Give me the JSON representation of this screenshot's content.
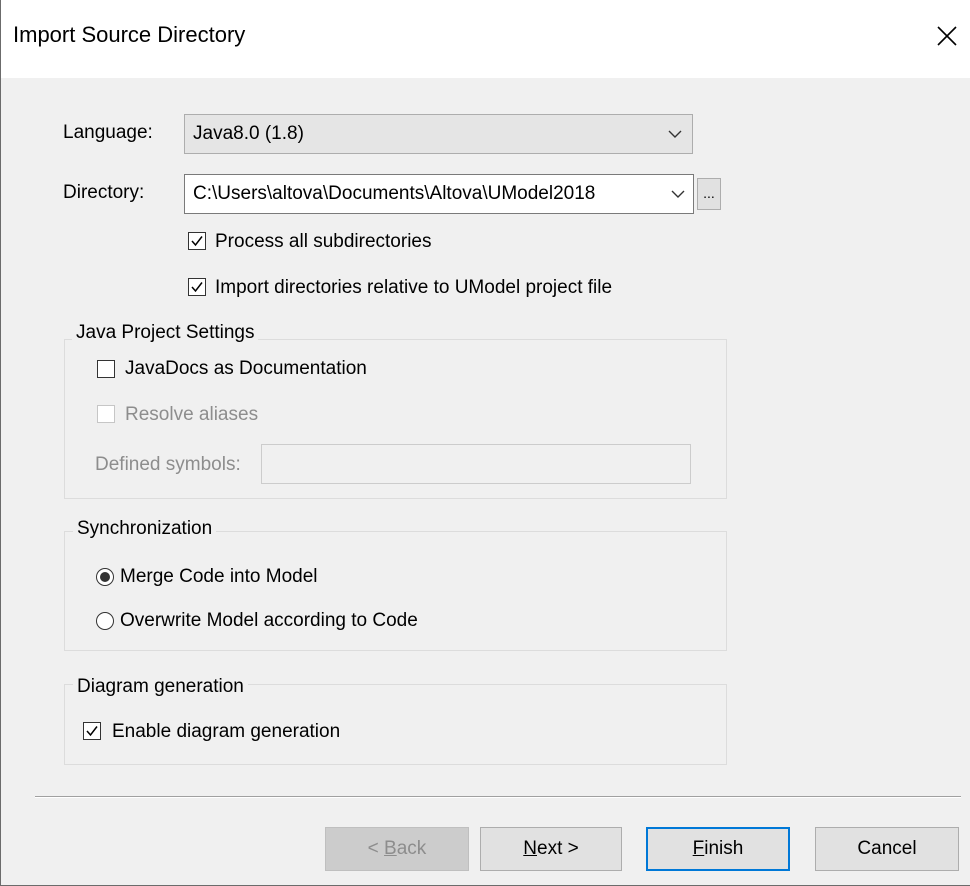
{
  "window": {
    "title": "Import Source Directory",
    "close_icon": "close-icon"
  },
  "language": {
    "label": "Language:",
    "value": "Java8.0 (1.8)"
  },
  "directory": {
    "label": "Directory:",
    "value": "C:\\Users\\altova\\Documents\\Altova\\UModel2018",
    "browse_label": "..."
  },
  "options": {
    "process_subdirs": {
      "label": "Process all subdirectories",
      "checked": true
    },
    "import_relative": {
      "label": "Import directories relative to UModel project file",
      "checked": true
    }
  },
  "java_settings": {
    "title": "Java Project Settings",
    "javadocs": {
      "label": "JavaDocs as Documentation",
      "checked": false
    },
    "resolve_aliases": {
      "label": "Resolve aliases",
      "checked": false,
      "enabled": false
    },
    "defined_symbols": {
      "label": "Defined symbols:",
      "value": ""
    }
  },
  "synchronization": {
    "title": "Synchronization",
    "options": [
      {
        "label": "Merge Code into Model",
        "selected": true
      },
      {
        "label": "Overwrite Model according to Code",
        "selected": false
      }
    ]
  },
  "diagram_generation": {
    "title": "Diagram generation",
    "enable": {
      "label": "Enable diagram generation",
      "checked": true
    }
  },
  "buttons": {
    "back": {
      "prefix": "< ",
      "mnemonic": "B",
      "rest": "ack"
    },
    "next": {
      "mnemonic": "N",
      "rest": "ext >"
    },
    "finish": {
      "mnemonic": "F",
      "rest": "inish"
    },
    "cancel": "Cancel"
  },
  "colors": {
    "accent": "#0078d7",
    "dialog_bg": "#f0f0f0",
    "disabled_text": "#8d8d8d"
  }
}
